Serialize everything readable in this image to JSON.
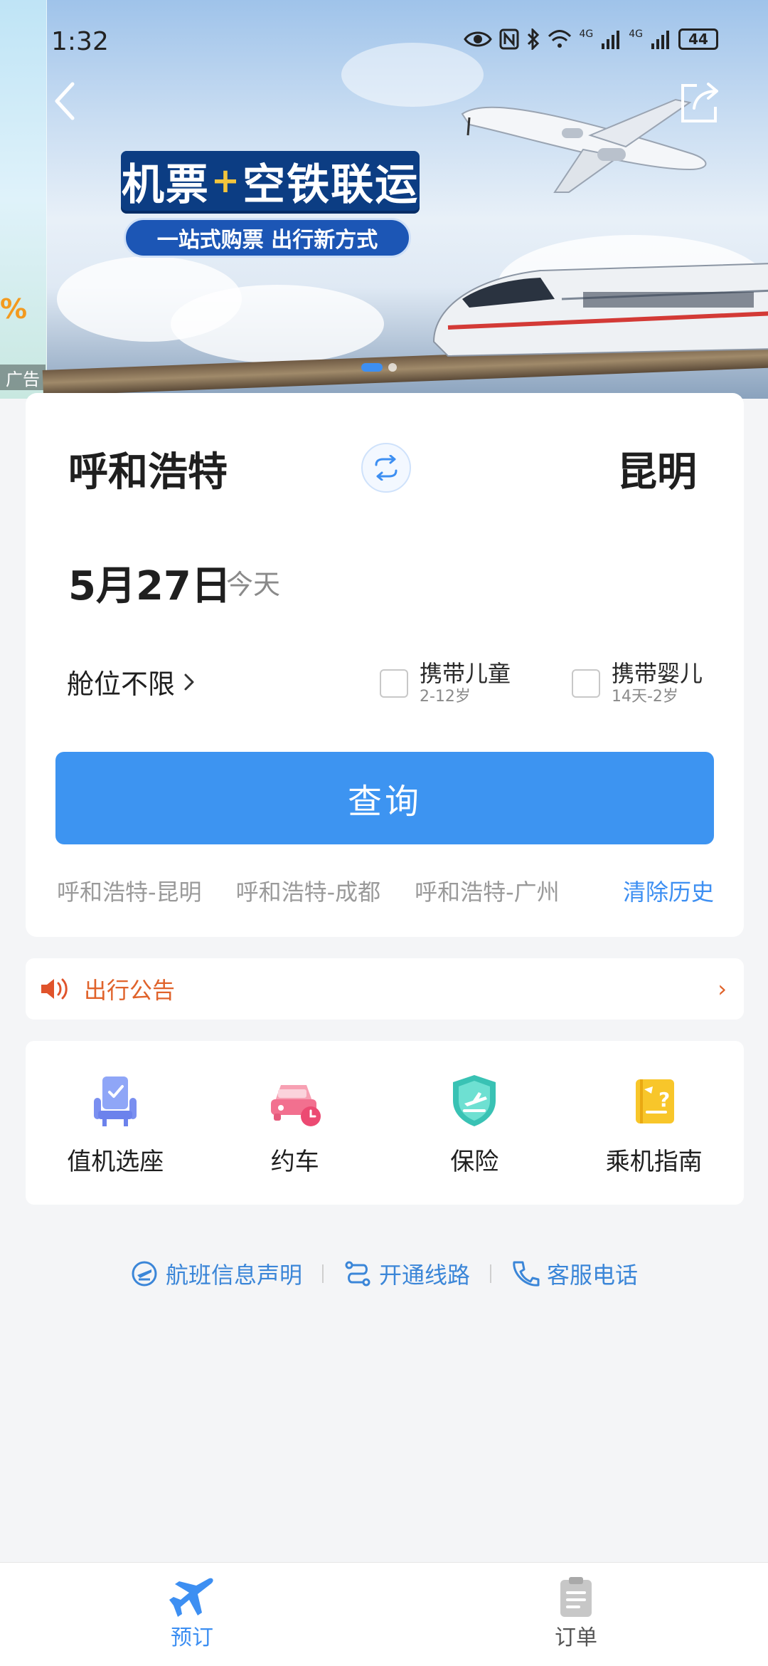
{
  "status_bar": {
    "time": "1:32",
    "battery": "44",
    "net1": "4G",
    "net2": "4G"
  },
  "banner": {
    "title_part1": "机票",
    "plus": "+",
    "title_part2": "空铁联运",
    "subtitle": "一站式购票 出行新方式",
    "ad_tag": "广告",
    "prev_banner_text": "%"
  },
  "search": {
    "from_city": "呼和浩特",
    "to_city": "昆明",
    "date": "5月27日",
    "date_hint": "今天",
    "cabin": "舱位不限",
    "child_label": "携带儿童",
    "child_age": "2-12岁",
    "infant_label": "携带婴儿",
    "infant_age": "14天-2岁",
    "button": "查询",
    "history": [
      "呼和浩特-昆明",
      "呼和浩特-成都",
      "呼和浩特-广州"
    ],
    "clear_history": "清除历史"
  },
  "notice": {
    "text": "出行公告",
    "arrow": "›"
  },
  "services": [
    {
      "label": "值机选座",
      "icon": "seat-icon"
    },
    {
      "label": "约车",
      "icon": "car-icon"
    },
    {
      "label": "保险",
      "icon": "insurance-icon"
    },
    {
      "label": "乘机指南",
      "icon": "guide-icon"
    }
  ],
  "footer_links": {
    "flight_info": "航班信息声明",
    "routes": "开通线路",
    "service_phone": "客服电话"
  },
  "tabs": {
    "book": "预订",
    "orders": "订单"
  },
  "colors": {
    "accent": "#3d94f1",
    "notice": "#e0632b",
    "link": "#3b86d8"
  }
}
